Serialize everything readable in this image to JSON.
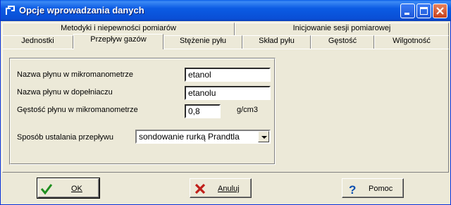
{
  "window": {
    "title": "Opcje wprowadzania danych"
  },
  "tabs": {
    "row1": [
      "Metodyki i niepewności pomiarów",
      "Inicjowanie sesji pomiarowej"
    ],
    "row2": [
      "Jednostki",
      "Przepływ gazów",
      "Stężenie pyłu",
      "Skład pyłu",
      "Gęstość",
      "Wilgotność"
    ],
    "active": "Przepływ gazów"
  },
  "form": {
    "fluid_micromanometer_label": "Nazwa płynu w mikromanometrze",
    "fluid_micromanometer_value": "etanol",
    "fluid_genitive_label": "Nazwa płynu w dopełniaczu",
    "fluid_genitive_value": "etanolu",
    "density_label": "Gęstość płynu w mikromanometrze",
    "density_value": "0,8",
    "density_unit": "g/cm3",
    "flow_method_label": "Sposób ustalania przepływu",
    "flow_method_value": "sondowanie rurką Prandtla"
  },
  "buttons": {
    "ok": "OK",
    "cancel": "Anuluj",
    "help": "Pomoc"
  }
}
